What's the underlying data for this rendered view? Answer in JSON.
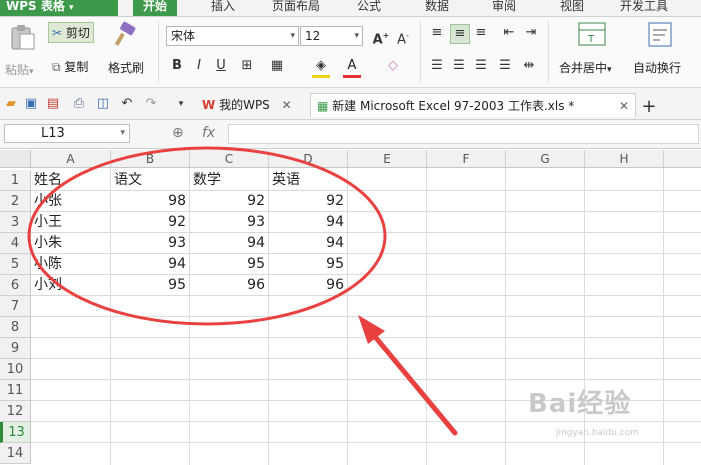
{
  "app": {
    "name": "WPS 表格"
  },
  "ribbon_tabs": [
    {
      "label": "开始",
      "active": true
    },
    {
      "label": "插入"
    },
    {
      "label": "页面布局"
    },
    {
      "label": "公式"
    },
    {
      "label": "数据"
    },
    {
      "label": "审阅"
    },
    {
      "label": "视图"
    },
    {
      "label": "开发工具"
    }
  ],
  "ribbon": {
    "paste": "粘贴",
    "cut": "剪切",
    "copy": "复制",
    "format_painter": "格式刷",
    "font_name": "宋体",
    "font_size": "12",
    "merge_center": "合并居中",
    "wrap_text": "自动换行",
    "bold": "B",
    "italic": "I",
    "underline": "U"
  },
  "doc_tabs": [
    {
      "label": "我的WPS"
    },
    {
      "label": "新建 Microsoft Excel 97-2003 工作表.xls *",
      "active": true
    }
  ],
  "formula_bar": {
    "cell_ref": "L13",
    "fx": "fx"
  },
  "sheet": {
    "columns": [
      "A",
      "B",
      "C",
      "D",
      "E",
      "F",
      "G",
      "H"
    ],
    "rows": [
      "1",
      "2",
      "3",
      "4",
      "5",
      "6",
      "7",
      "8",
      "9",
      "10",
      "11",
      "12",
      "13",
      "14"
    ],
    "selected_row": "13",
    "header": [
      "姓名",
      "语文",
      "数学",
      "英语"
    ],
    "data": [
      [
        "小张",
        "98",
        "92",
        "92"
      ],
      [
        "小王",
        "92",
        "93",
        "94"
      ],
      [
        "小朱",
        "93",
        "94",
        "94"
      ],
      [
        "小陈",
        "94",
        "95",
        "95"
      ],
      [
        "小刘",
        "95",
        "96",
        "96"
      ]
    ]
  },
  "annotation": {
    "ellipse_color": "#e8413f",
    "arrow_color": "#e8413f"
  },
  "watermark": {
    "text": "Bai经验",
    "sub": "jingyan.baidu.com"
  }
}
